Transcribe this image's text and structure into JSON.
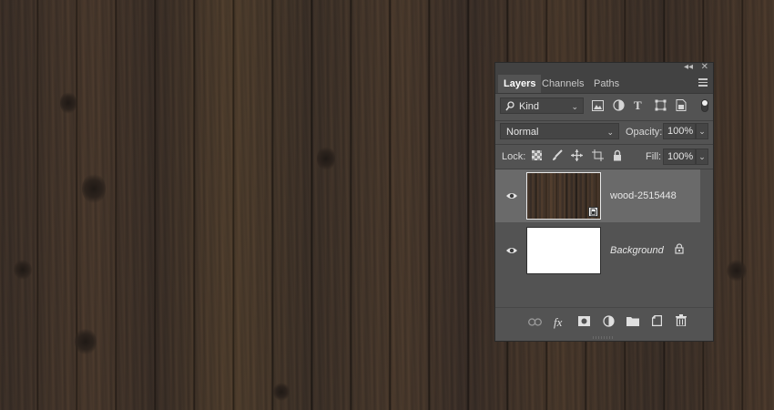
{
  "panel": {
    "tabs": [
      {
        "label": "Layers",
        "active": true
      },
      {
        "label": "Channels",
        "active": false
      },
      {
        "label": "Paths",
        "active": false
      }
    ],
    "topbar": {
      "collapse_glyph": "◂◂",
      "close_glyph": "✕"
    },
    "filter": {
      "kind_label": "Kind",
      "icons": [
        "image-filter-icon",
        "adjustment-filter-icon",
        "type-filter-icon",
        "shape-filter-icon",
        "smart-object-filter-icon"
      ]
    },
    "blend": {
      "mode": "Normal",
      "opacity_label": "Opacity:",
      "opacity_value": "100%"
    },
    "lock": {
      "label": "Lock:",
      "fill_label": "Fill:",
      "fill_value": "100%"
    },
    "layers": [
      {
        "name": "wood-2515448",
        "selected": true,
        "type": "smart-object",
        "visible": true
      },
      {
        "name": "Background",
        "selected": false,
        "type": "background",
        "visible": true,
        "locked": true
      }
    ],
    "footer_icons": [
      "link-layers-icon",
      "fx-icon",
      "layer-mask-icon",
      "adjustment-layer-icon",
      "group-folder-icon",
      "new-layer-icon",
      "trash-icon"
    ],
    "fx_text": "fx"
  },
  "colors": {
    "panel_bg": "#535353",
    "tab_bar_bg": "#424242",
    "selected_layer_bg": "#6a6a6a",
    "wood_dark": "#3a2f28",
    "wood_light": "#51402f"
  }
}
